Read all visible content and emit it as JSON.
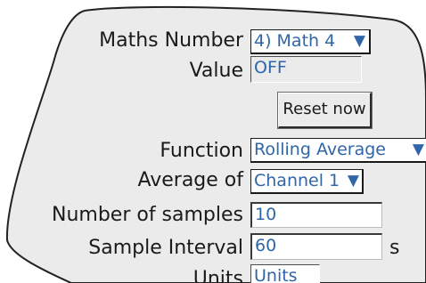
{
  "fields": {
    "maths_number": {
      "label": "Maths Number",
      "value": "4) Math 4"
    },
    "value": {
      "label": "Value",
      "value": "OFF"
    },
    "reset": {
      "label": "Reset now"
    },
    "function": {
      "label": "Function",
      "value": "Rolling Average"
    },
    "average_of": {
      "label": "Average of",
      "value": "Channel 1"
    },
    "num_samples": {
      "label": "Number of samples",
      "value": "10"
    },
    "sample_interval": {
      "label": "Sample Interval",
      "value": "60",
      "unit": "s"
    },
    "units": {
      "label": "Units",
      "value": "Units"
    }
  },
  "icons": {
    "dropdown": "dropdown-triangle-icon"
  },
  "colors": {
    "panel": "#ebebeb",
    "value_text": "#2f66a8",
    "label_text": "#1a1a1a"
  }
}
